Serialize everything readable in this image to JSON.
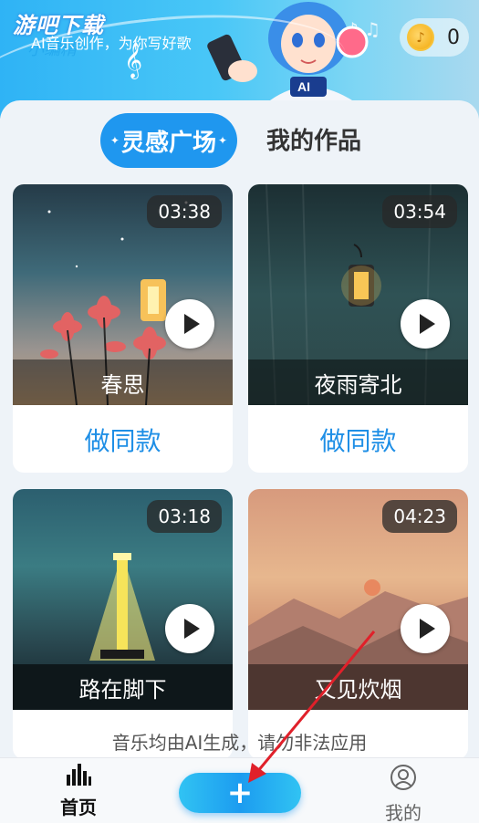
{
  "header": {
    "watermark": "游吧下载",
    "slogan": "AI音乐创作，为你写好歌",
    "coins": "0"
  },
  "tabs": [
    {
      "label": "灵感广场",
      "active": true
    },
    {
      "label": "我的作品",
      "active": false
    }
  ],
  "cards": [
    {
      "title": "春思",
      "duration": "03:38",
      "action": "做同款"
    },
    {
      "title": "夜雨寄北",
      "duration": "03:54",
      "action": "做同款"
    },
    {
      "title": "路在脚下",
      "duration": "03:18"
    },
    {
      "title": "又见炊烟",
      "duration": "04:23"
    }
  ],
  "footer_note": "音乐均由AI生成，请勿非法应用",
  "nav": {
    "home": "首页",
    "create": "+",
    "mine": "我的"
  },
  "colors": {
    "accent": "#1f97ef",
    "arrow": "#e0202a"
  }
}
